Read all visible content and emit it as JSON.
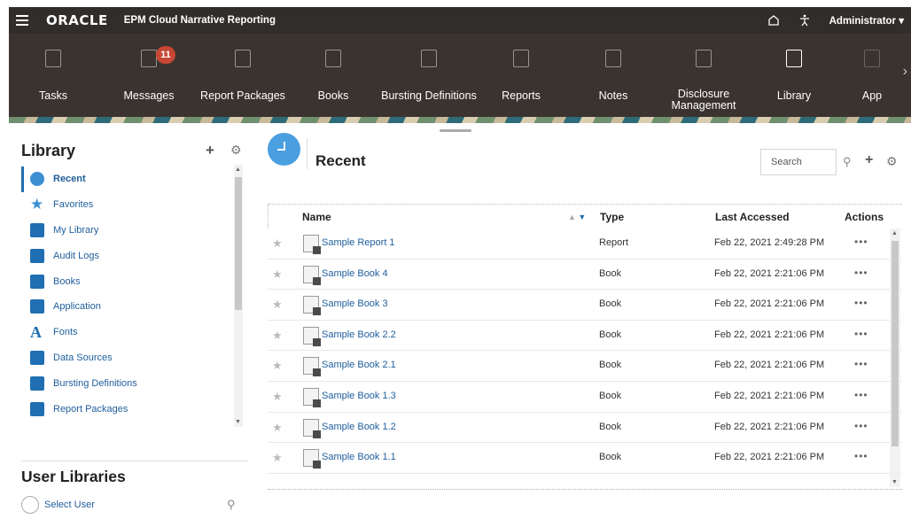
{
  "topbar": {
    "logo": "ORACLE",
    "app_name": "EPM Cloud Narrative Reporting",
    "user": "Administrator ▾"
  },
  "nav": {
    "items": [
      {
        "label": "Tasks",
        "icon": "tasks-icon"
      },
      {
        "label": "Messages",
        "icon": "messages-icon",
        "badge": "11"
      },
      {
        "label": "Report Packages",
        "icon": "report-packages-icon"
      },
      {
        "label": "Books",
        "icon": "books-icon"
      },
      {
        "label": "Bursting Definitions",
        "icon": "bursting-definitions-icon"
      },
      {
        "label": "Reports",
        "icon": "reports-icon"
      },
      {
        "label": "Notes",
        "icon": "notes-icon"
      },
      {
        "label": "Disclosure Management",
        "icon": "disclosure-management-icon"
      },
      {
        "label": "Library",
        "icon": "library-icon"
      },
      {
        "label": "App",
        "icon": "app-icon"
      }
    ]
  },
  "library": {
    "title": "Library",
    "items": [
      {
        "label": "Recent",
        "icon": "clock-icon",
        "active": true
      },
      {
        "label": "Favorites",
        "icon": "star-icon"
      },
      {
        "label": "My Library",
        "icon": "user-icon"
      },
      {
        "label": "Audit Logs",
        "icon": "audit-logs-icon"
      },
      {
        "label": "Books",
        "icon": "books-icon"
      },
      {
        "label": "Application",
        "icon": "cube-icon"
      },
      {
        "label": "Fonts",
        "icon": "font-icon"
      },
      {
        "label": "Data Sources",
        "icon": "data-sources-icon"
      },
      {
        "label": "Bursting Definitions",
        "icon": "bursting-definitions-icon"
      },
      {
        "label": "Report Packages",
        "icon": "report-packages-icon"
      }
    ],
    "user_libraries_title": "User Libraries",
    "select_user": "Select User"
  },
  "main": {
    "title": "Recent",
    "search_placeholder": "Search",
    "columns": {
      "name": "Name",
      "type": "Type",
      "last_accessed": "Last Accessed",
      "actions": "Actions"
    },
    "rows": [
      {
        "name": "Sample Report 1",
        "type": "Report",
        "date": "Feb 22, 2021 2:49:28 PM",
        "actions": "•••"
      },
      {
        "name": "Sample Book 4",
        "type": "Book",
        "date": "Feb 22, 2021 2:21:06 PM",
        "actions": "•••"
      },
      {
        "name": "Sample Book 3",
        "type": "Book",
        "date": "Feb 22, 2021 2:21:06 PM",
        "actions": "•••"
      },
      {
        "name": "Sample Book 2.2",
        "type": "Book",
        "date": "Feb 22, 2021 2:21:06 PM",
        "actions": "•••"
      },
      {
        "name": "Sample Book 2.1",
        "type": "Book",
        "date": "Feb 22, 2021 2:21:06 PM",
        "actions": "•••"
      },
      {
        "name": "Sample Book 1.3",
        "type": "Book",
        "date": "Feb 22, 2021 2:21:06 PM",
        "actions": "•••"
      },
      {
        "name": "Sample Book 1.2",
        "type": "Book",
        "date": "Feb 22, 2021 2:21:06 PM",
        "actions": "•••"
      },
      {
        "name": "Sample Book 1.1",
        "type": "Book",
        "date": "Feb 22, 2021 2:21:06 PM",
        "actions": "•••"
      }
    ]
  },
  "colors": {
    "topbar": "#312d2a",
    "accent": "#1f6fb2",
    "badge": "#c74634",
    "link": "#1f5e9c"
  }
}
